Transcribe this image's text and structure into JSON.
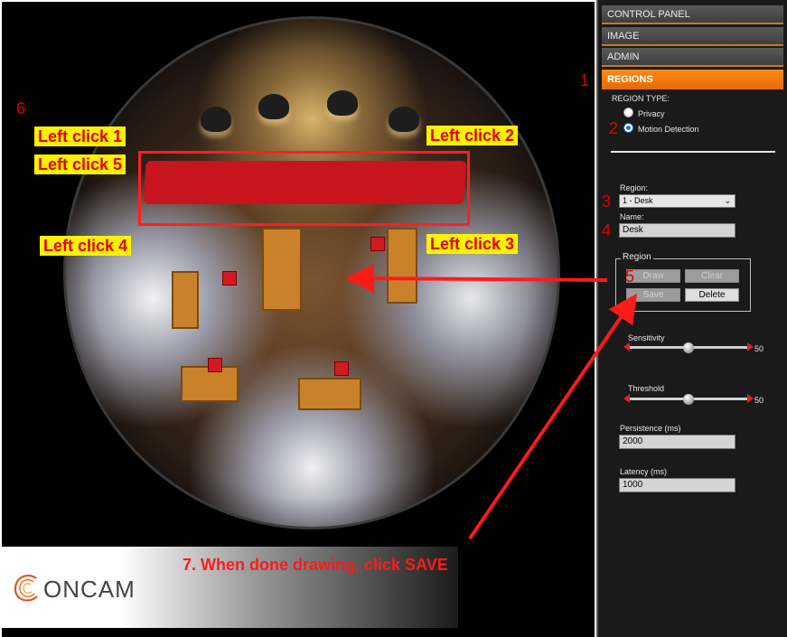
{
  "panel_menu": [
    {
      "label": "CONTROL PANEL",
      "active": false
    },
    {
      "label": "IMAGE",
      "active": false
    },
    {
      "label": "ADMIN",
      "active": false
    },
    {
      "label": "REGIONS",
      "active": true
    }
  ],
  "region_type": {
    "heading": "REGION TYPE:",
    "options": [
      {
        "label": "Privacy",
        "selected": false
      },
      {
        "label": "Motion Detection",
        "selected": true
      }
    ]
  },
  "region_select": {
    "label": "Region:",
    "value": "1 - Desk"
  },
  "name_field": {
    "label": "Name:",
    "value": "Desk"
  },
  "region_group": {
    "legend": "Region",
    "buttons": {
      "draw": "Draw",
      "clear": "Clear",
      "save": "Save",
      "delete": "Delete"
    }
  },
  "sensitivity": {
    "label": "Sensitivity",
    "value": "50",
    "level": 0.5
  },
  "threshold": {
    "label": "Threshold",
    "value": "50",
    "level": 0.5
  },
  "persistence": {
    "label": "Persistence (ms)",
    "value": "2000"
  },
  "latency": {
    "label": "Latency (ms)",
    "value": "1000"
  },
  "annotations": {
    "step_1": "1",
    "step_2": "2",
    "step_3": "3",
    "step_4": "4",
    "step_5": "5",
    "step_6": "6",
    "click_1": "Left click 1",
    "click_2": "Left click 2",
    "click_3": "Left click 3",
    "click_4": "Left click 4",
    "click_5": "Left click 5",
    "instruction": "7. When done drawing, click SAVE"
  },
  "brand": {
    "logo_text": "ONCAM"
  },
  "colors": {
    "accent": "#ff8c1a",
    "annotation_red": "#e10000",
    "callout_yellow": "#fff200"
  }
}
